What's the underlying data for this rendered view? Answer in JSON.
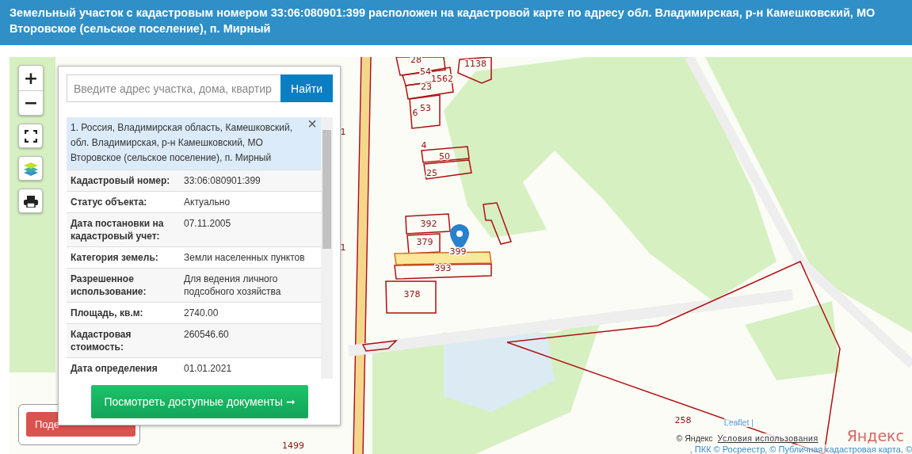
{
  "header": {
    "title": "Земельный участок с кадастровым номером **33:06:080901:399** расположен на кадастровой карте по адресу обл. Владимирская, р-н Камешковский, МО Второвское (сельское поселение), п. Мирный"
  },
  "map_controls": {
    "zoom_in": "+",
    "zoom_out": "−"
  },
  "share_button": {
    "label": "Поде"
  },
  "search": {
    "placeholder": "Введите адрес участка, дома, квартир",
    "button": "Найти"
  },
  "result": {
    "address": "1. Россия, Владимирская область, Камешковский, обл. Владимирская, р-н Камешковский, МО Второвское (сельское поселение), п. Мирный",
    "close": "×"
  },
  "details": [
    {
      "label": "Кадастровый номер:",
      "value": "33:06:080901:399"
    },
    {
      "label": "Статус объекта:",
      "value": "Актуально"
    },
    {
      "label": "Дата постановки на кадастровый учет:",
      "value": "07.11.2005"
    },
    {
      "label": "Категория земель:",
      "value": "Земли населенных пунктов"
    },
    {
      "label": "Разрешенное использование:",
      "value": "Для ведения личного подсобного хозяйства"
    },
    {
      "label": "Площадь, кв.м:",
      "value": "2740.00"
    },
    {
      "label": "Кадастровая стоимость:",
      "value": "260546.60"
    },
    {
      "label": "Дата определения",
      "value": "01.01.2021"
    }
  ],
  "documents_button": {
    "label": "Посмотреть доступные документы ➞"
  },
  "parcels": [
    "28",
    "54",
    "1138",
    "23",
    "1562",
    "53",
    "6",
    "4",
    "50",
    "25",
    "392",
    "379",
    "399",
    "393",
    "378",
    "1499",
    "1",
    "1",
    "258"
  ],
  "attribution": {
    "leaflet": "Leaflet |",
    "yandex": "© Яндекс",
    "terms": "Условия использования",
    "sources": ", ПКК © Росреестр, © Публичная кадастровая карта, ©",
    "logo": "Яндекс"
  }
}
